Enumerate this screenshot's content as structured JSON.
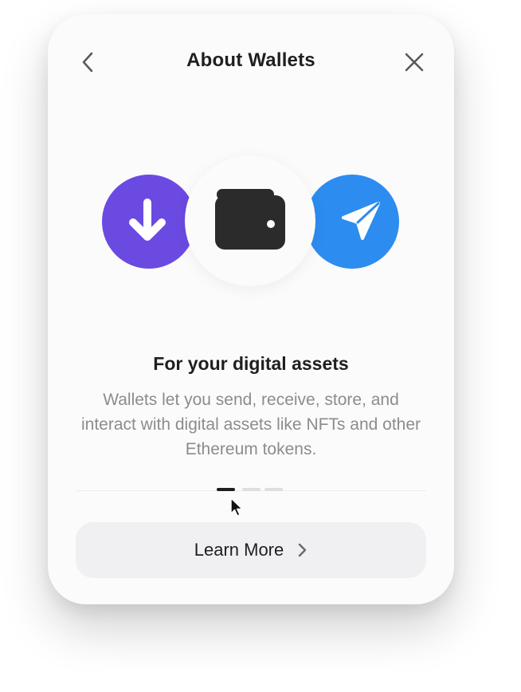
{
  "header": {
    "title": "About Wallets",
    "back_icon": "chevron-left-icon",
    "close_icon": "close-icon"
  },
  "illustration": {
    "left_icon": "arrow-down-icon",
    "center_icon": "wallet-icon",
    "right_icon": "send-icon",
    "colors": {
      "receive": "#6b4ae2",
      "send": "#2d8cf0",
      "wallet": "#2b2b2b"
    }
  },
  "content": {
    "heading": "For your digital assets",
    "description": "Wallets let you send, receive, store, and interact with digital assets like NFTs and other Ethereum tokens."
  },
  "pagination": {
    "total": 3,
    "current": 1
  },
  "footer": {
    "learn_more_label": "Learn More",
    "learn_more_icon": "chevron-right-icon"
  }
}
